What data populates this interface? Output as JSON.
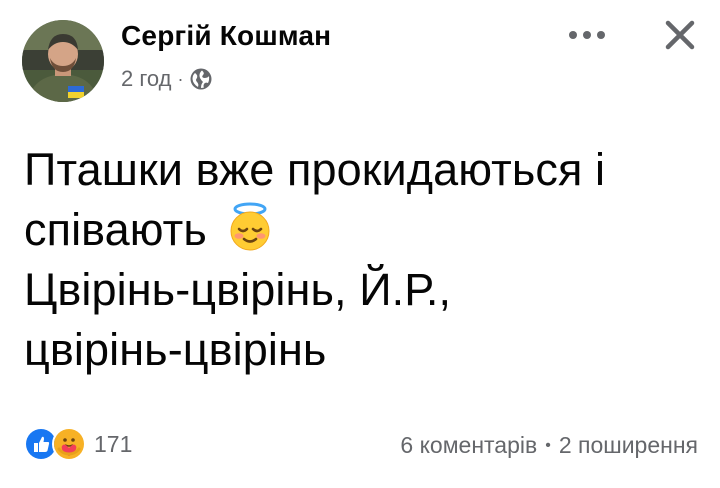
{
  "post": {
    "author": "Сергій Кошман",
    "timestamp": "2 год",
    "meta_separator": "·",
    "privacy_icon": "globe-icon",
    "text_lines": [
      "Пташки вже прокидаються і",
      "співають",
      "Цвірінь-цвірінь, Й.Р.,",
      "цвірінь-цвірінь"
    ],
    "inline_emoji": "smiling-face-with-halo"
  },
  "header_actions": {
    "more_icon": "more-dots-icon",
    "close_icon": "close-icon"
  },
  "footer": {
    "reactions": [
      "like-reaction-icon",
      "care-reaction-icon"
    ],
    "reaction_count": "171",
    "comments": "6 коментарів",
    "separator": "•",
    "shares": "2 поширення"
  },
  "colors": {
    "text_primary": "#050505",
    "text_secondary": "#65676b",
    "like_blue": "#1877f2",
    "background": "#ffffff"
  }
}
